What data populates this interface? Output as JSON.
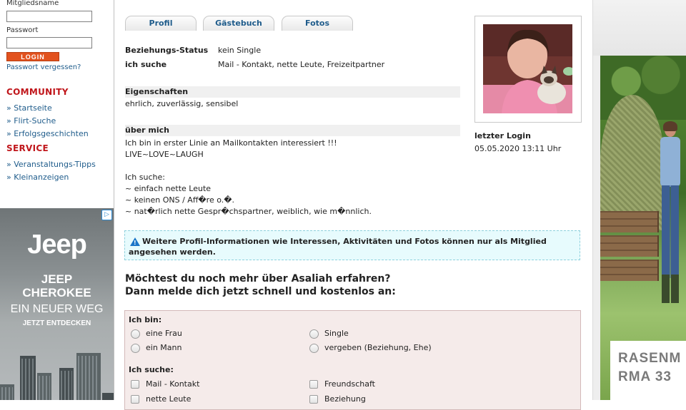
{
  "login": {
    "username_label": "Mitgliedsname",
    "username_value": "",
    "password_label": "Passwort",
    "password_value": "",
    "login_button": "LOGIN",
    "forgot_password": "Passwort vergessen?"
  },
  "nav": {
    "community_title": "COMMUNITY",
    "community_items": [
      "Startseite",
      "Flirt-Suche",
      "Erfolgsgeschichten"
    ],
    "service_title": "SERVICE",
    "service_items": [
      "Veranstaltungs-Tipps",
      "Kleinanzeigen"
    ],
    "bullet": "»"
  },
  "ad_left": {
    "brand": "Jeep",
    "line1": "JEEP",
    "line2": "CHEROKEE",
    "line3": "EIN NEUER WEG",
    "line4": "JETZT ENTDECKEN",
    "badge": "▷"
  },
  "tabs": [
    "Profil",
    "Gästebuch",
    "Fotos"
  ],
  "profile": {
    "relationship_label": "Beziehungs-Status",
    "relationship_value": "kein Single",
    "seeking_label": "ich suche",
    "seeking_value": "Mail - Kontakt, nette Leute, Freizeitpartner",
    "traits_title": "Eigenschaften",
    "traits_value": "ehrlich, zuverlässig, sensibel",
    "about_title": "über mich",
    "about_lines": [
      "Ich bin in erster Linie an Mailkontakten interessiert !!!",
      "LIVE~LOVE~LAUGH",
      "",
      "Ich suche:",
      "~ einfach nette Leute",
      "~ keinen ONS / Aff�re o.�.",
      "~ nat�rlich nette Gespr�chspartner, weiblich, wie m�nnlich."
    ],
    "last_login_label": "letzter Login",
    "last_login_value": "05.05.2020 13:11 Uhr"
  },
  "info": {
    "icon": "warning-icon",
    "text_line1": "Weitere Profil-Informationen wie Interessen, Aktivitäten und Fotos können nur als Mitglied",
    "text_line2": "angesehen werden."
  },
  "cta": {
    "line1": "Möchtest du noch mehr über Asaliah erfahren?",
    "line2": "Dann melde dich jetzt schnell und kostenlos an:"
  },
  "form": {
    "ich_bin_label": "Ich bin:",
    "ich_bin_options": [
      "eine Frau",
      "ein Mann"
    ],
    "status_options": [
      "Single",
      "vergeben (Beziehung, Ehe)"
    ],
    "ich_suche_label": "Ich suche:",
    "suche_left": [
      "Mail - Kontakt",
      "nette Leute"
    ],
    "suche_right": [
      "Freundschaft",
      "Beziehung"
    ]
  },
  "ad_right": {
    "text1": "RASENM",
    "text2": "RMA 33"
  },
  "colors": {
    "accent_red": "#c0161b",
    "link_blue": "#1f5c8b",
    "login_orange": "#e2521e",
    "info_bg": "#e7fbfd",
    "form_bg": "#f5ebea"
  }
}
